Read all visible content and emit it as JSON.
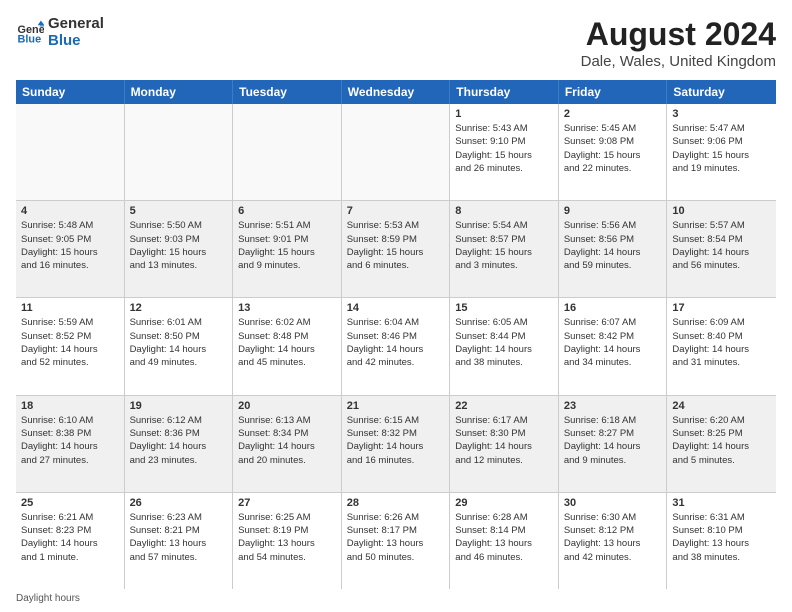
{
  "logo": {
    "line1": "General",
    "line2": "Blue"
  },
  "title": "August 2024",
  "subtitle": "Dale, Wales, United Kingdom",
  "days": [
    "Sunday",
    "Monday",
    "Tuesday",
    "Wednesday",
    "Thursday",
    "Friday",
    "Saturday"
  ],
  "weeks": [
    [
      {
        "date": "",
        "info": ""
      },
      {
        "date": "",
        "info": ""
      },
      {
        "date": "",
        "info": ""
      },
      {
        "date": "",
        "info": ""
      },
      {
        "date": "1",
        "info": "Sunrise: 5:43 AM\nSunset: 9:10 PM\nDaylight: 15 hours\nand 26 minutes."
      },
      {
        "date": "2",
        "info": "Sunrise: 5:45 AM\nSunset: 9:08 PM\nDaylight: 15 hours\nand 22 minutes."
      },
      {
        "date": "3",
        "info": "Sunrise: 5:47 AM\nSunset: 9:06 PM\nDaylight: 15 hours\nand 19 minutes."
      }
    ],
    [
      {
        "date": "4",
        "info": "Sunrise: 5:48 AM\nSunset: 9:05 PM\nDaylight: 15 hours\nand 16 minutes."
      },
      {
        "date": "5",
        "info": "Sunrise: 5:50 AM\nSunset: 9:03 PM\nDaylight: 15 hours\nand 13 minutes."
      },
      {
        "date": "6",
        "info": "Sunrise: 5:51 AM\nSunset: 9:01 PM\nDaylight: 15 hours\nand 9 minutes."
      },
      {
        "date": "7",
        "info": "Sunrise: 5:53 AM\nSunset: 8:59 PM\nDaylight: 15 hours\nand 6 minutes."
      },
      {
        "date": "8",
        "info": "Sunrise: 5:54 AM\nSunset: 8:57 PM\nDaylight: 15 hours\nand 3 minutes."
      },
      {
        "date": "9",
        "info": "Sunrise: 5:56 AM\nSunset: 8:56 PM\nDaylight: 14 hours\nand 59 minutes."
      },
      {
        "date": "10",
        "info": "Sunrise: 5:57 AM\nSunset: 8:54 PM\nDaylight: 14 hours\nand 56 minutes."
      }
    ],
    [
      {
        "date": "11",
        "info": "Sunrise: 5:59 AM\nSunset: 8:52 PM\nDaylight: 14 hours\nand 52 minutes."
      },
      {
        "date": "12",
        "info": "Sunrise: 6:01 AM\nSunset: 8:50 PM\nDaylight: 14 hours\nand 49 minutes."
      },
      {
        "date": "13",
        "info": "Sunrise: 6:02 AM\nSunset: 8:48 PM\nDaylight: 14 hours\nand 45 minutes."
      },
      {
        "date": "14",
        "info": "Sunrise: 6:04 AM\nSunset: 8:46 PM\nDaylight: 14 hours\nand 42 minutes."
      },
      {
        "date": "15",
        "info": "Sunrise: 6:05 AM\nSunset: 8:44 PM\nDaylight: 14 hours\nand 38 minutes."
      },
      {
        "date": "16",
        "info": "Sunrise: 6:07 AM\nSunset: 8:42 PM\nDaylight: 14 hours\nand 34 minutes."
      },
      {
        "date": "17",
        "info": "Sunrise: 6:09 AM\nSunset: 8:40 PM\nDaylight: 14 hours\nand 31 minutes."
      }
    ],
    [
      {
        "date": "18",
        "info": "Sunrise: 6:10 AM\nSunset: 8:38 PM\nDaylight: 14 hours\nand 27 minutes."
      },
      {
        "date": "19",
        "info": "Sunrise: 6:12 AM\nSunset: 8:36 PM\nDaylight: 14 hours\nand 23 minutes."
      },
      {
        "date": "20",
        "info": "Sunrise: 6:13 AM\nSunset: 8:34 PM\nDaylight: 14 hours\nand 20 minutes."
      },
      {
        "date": "21",
        "info": "Sunrise: 6:15 AM\nSunset: 8:32 PM\nDaylight: 14 hours\nand 16 minutes."
      },
      {
        "date": "22",
        "info": "Sunrise: 6:17 AM\nSunset: 8:30 PM\nDaylight: 14 hours\nand 12 minutes."
      },
      {
        "date": "23",
        "info": "Sunrise: 6:18 AM\nSunset: 8:27 PM\nDaylight: 14 hours\nand 9 minutes."
      },
      {
        "date": "24",
        "info": "Sunrise: 6:20 AM\nSunset: 8:25 PM\nDaylight: 14 hours\nand 5 minutes."
      }
    ],
    [
      {
        "date": "25",
        "info": "Sunrise: 6:21 AM\nSunset: 8:23 PM\nDaylight: 14 hours\nand 1 minute."
      },
      {
        "date": "26",
        "info": "Sunrise: 6:23 AM\nSunset: 8:21 PM\nDaylight: 13 hours\nand 57 minutes."
      },
      {
        "date": "27",
        "info": "Sunrise: 6:25 AM\nSunset: 8:19 PM\nDaylight: 13 hours\nand 54 minutes."
      },
      {
        "date": "28",
        "info": "Sunrise: 6:26 AM\nSunset: 8:17 PM\nDaylight: 13 hours\nand 50 minutes."
      },
      {
        "date": "29",
        "info": "Sunrise: 6:28 AM\nSunset: 8:14 PM\nDaylight: 13 hours\nand 46 minutes."
      },
      {
        "date": "30",
        "info": "Sunrise: 6:30 AM\nSunset: 8:12 PM\nDaylight: 13 hours\nand 42 minutes."
      },
      {
        "date": "31",
        "info": "Sunrise: 6:31 AM\nSunset: 8:10 PM\nDaylight: 13 hours\nand 38 minutes."
      }
    ]
  ],
  "footer": "Daylight hours"
}
